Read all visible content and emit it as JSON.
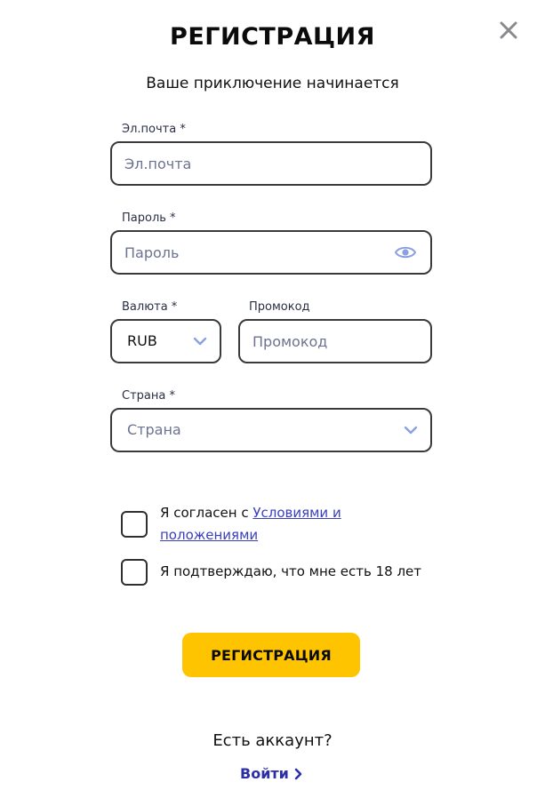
{
  "dialog": {
    "title": "РЕГИСТРАЦИЯ",
    "subtitle": "Ваше приключение начинается"
  },
  "form": {
    "email": {
      "label": "Эл.почта *",
      "placeholder": "Эл.почта",
      "value": ""
    },
    "password": {
      "label": "Пароль *",
      "placeholder": "Пароль",
      "value": ""
    },
    "currency": {
      "label": "Валюта *",
      "value": "RUB"
    },
    "promo": {
      "label": "Промокод",
      "placeholder": "Промокод",
      "value": ""
    },
    "country": {
      "label": "Страна *",
      "placeholder": "Страна"
    }
  },
  "agreements": {
    "terms_prefix": "Я согласен с ",
    "terms_link_line1": "Условиями и",
    "terms_link_line2": "положениями",
    "age": "Я подтверждаю, что мне есть 18 лет"
  },
  "actions": {
    "register_label": "РЕГИСТРАЦИЯ",
    "have_account": "Есть аккаунт?",
    "login_label": "Войти"
  },
  "colors": {
    "accent": "#ffc400",
    "link": "#2d2fa8",
    "icon": "#8aa0e0"
  },
  "icons": {
    "close": "close-icon",
    "eye": "eye-icon",
    "chevron_down": "chevron-down-icon",
    "chevron_right": "chevron-right-icon"
  }
}
